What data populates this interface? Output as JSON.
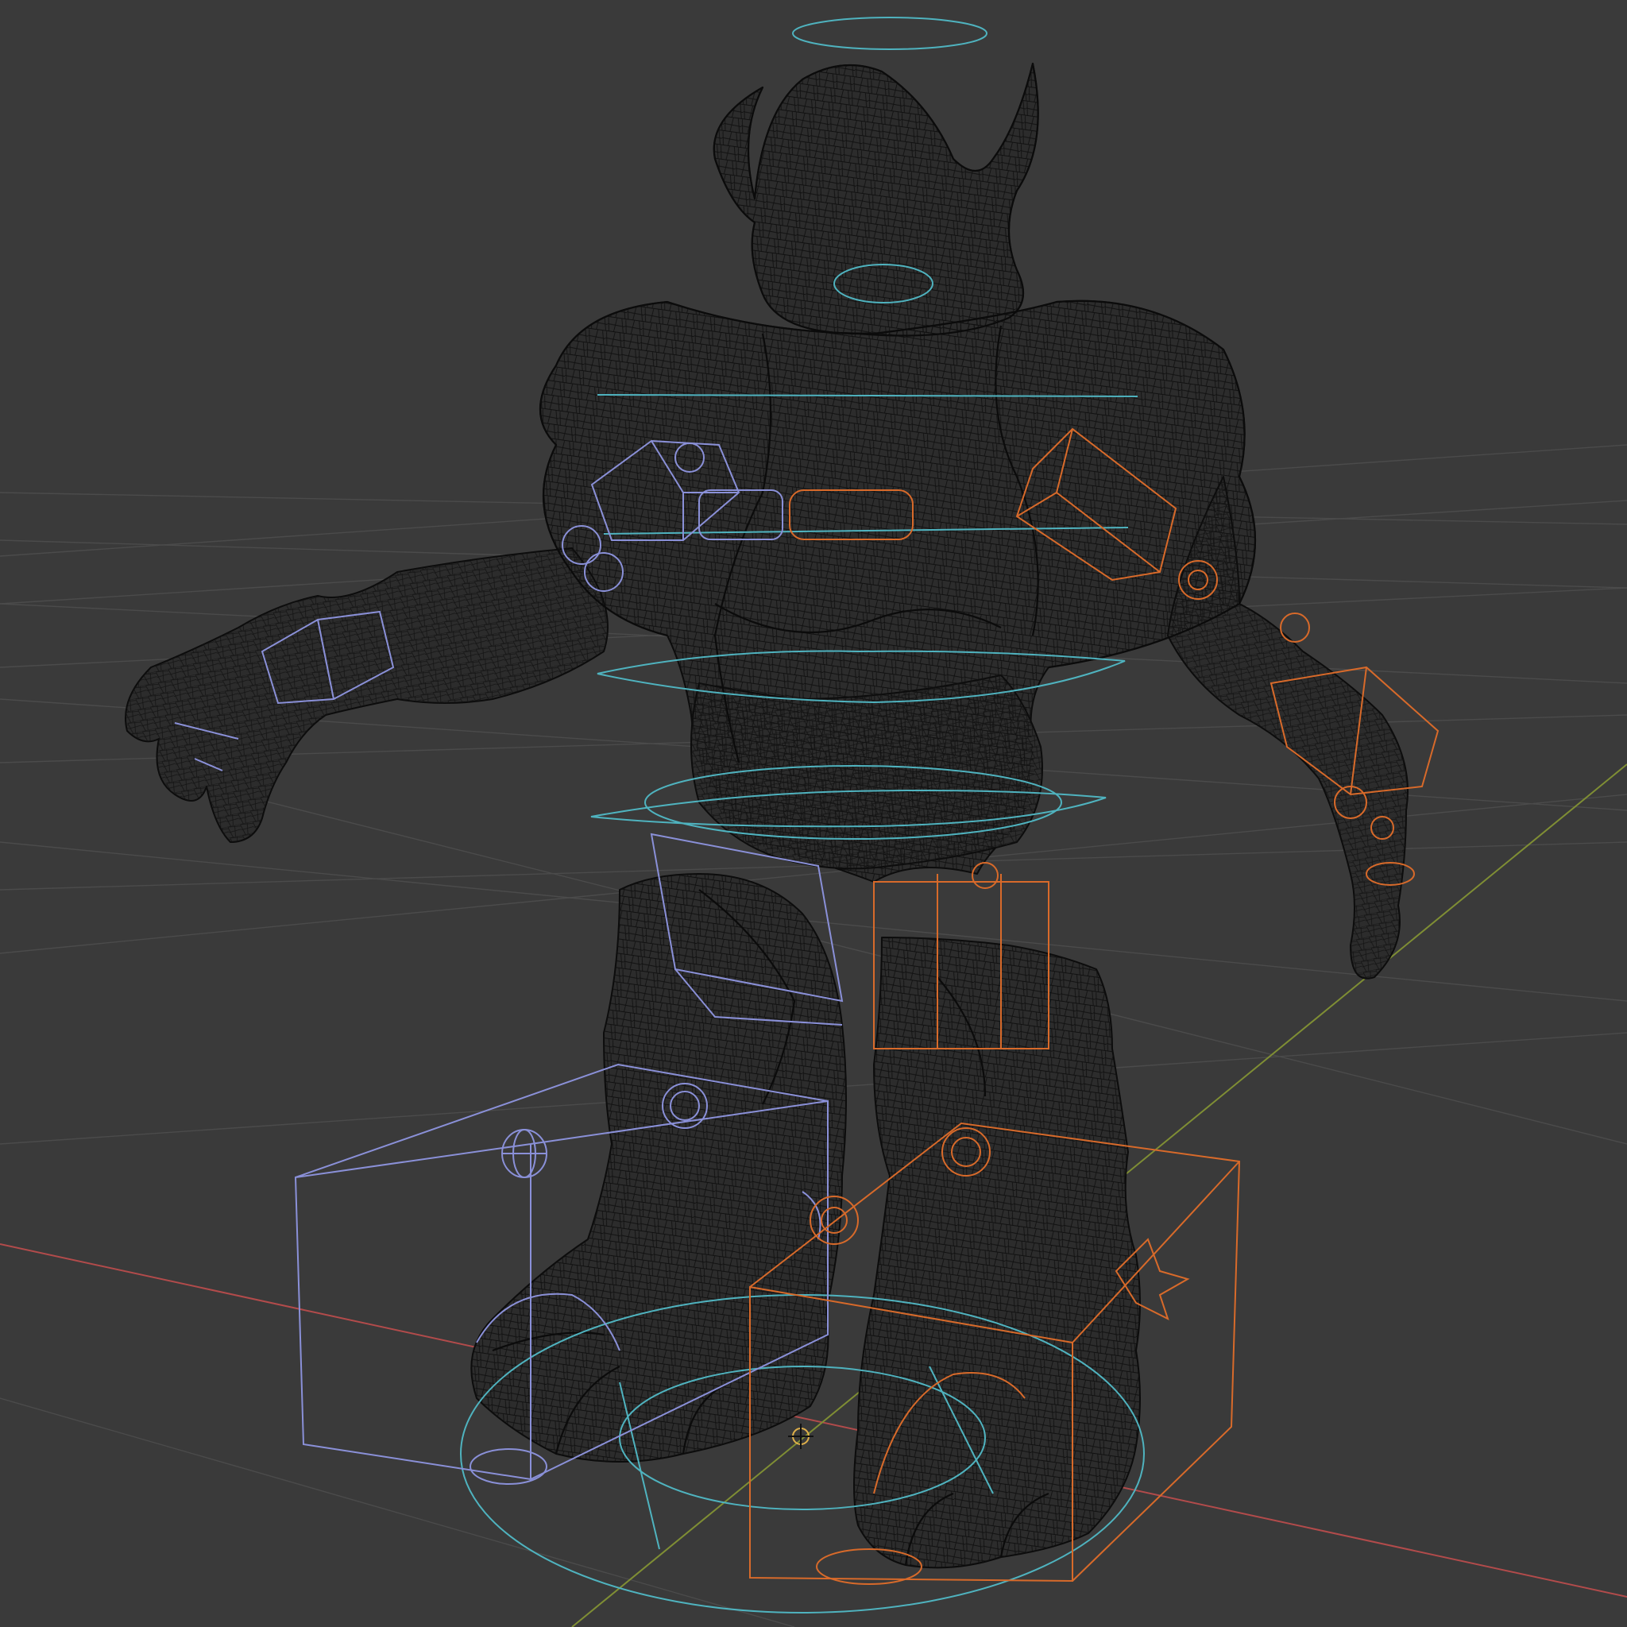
{
  "viewport": {
    "mode": "wireframe",
    "background_color": "#3a3a3a",
    "grid_color": "#4a4a4a",
    "x_axis_color": "#c0504d",
    "y_axis_color": "#8a9a3a",
    "mesh_color": "#0d0d0d",
    "mesh_fill_color": "#2b2b2b",
    "controls": {
      "cyan_color": "#4fb3bf",
      "left_side_color": "#8a90d8",
      "right_side_color": "#d86a2a"
    },
    "icons": {
      "scene_cursor": "3d-cursor-icon",
      "pole_target": "pole-target-icon",
      "gear_control": "gear-control-icon"
    }
  }
}
